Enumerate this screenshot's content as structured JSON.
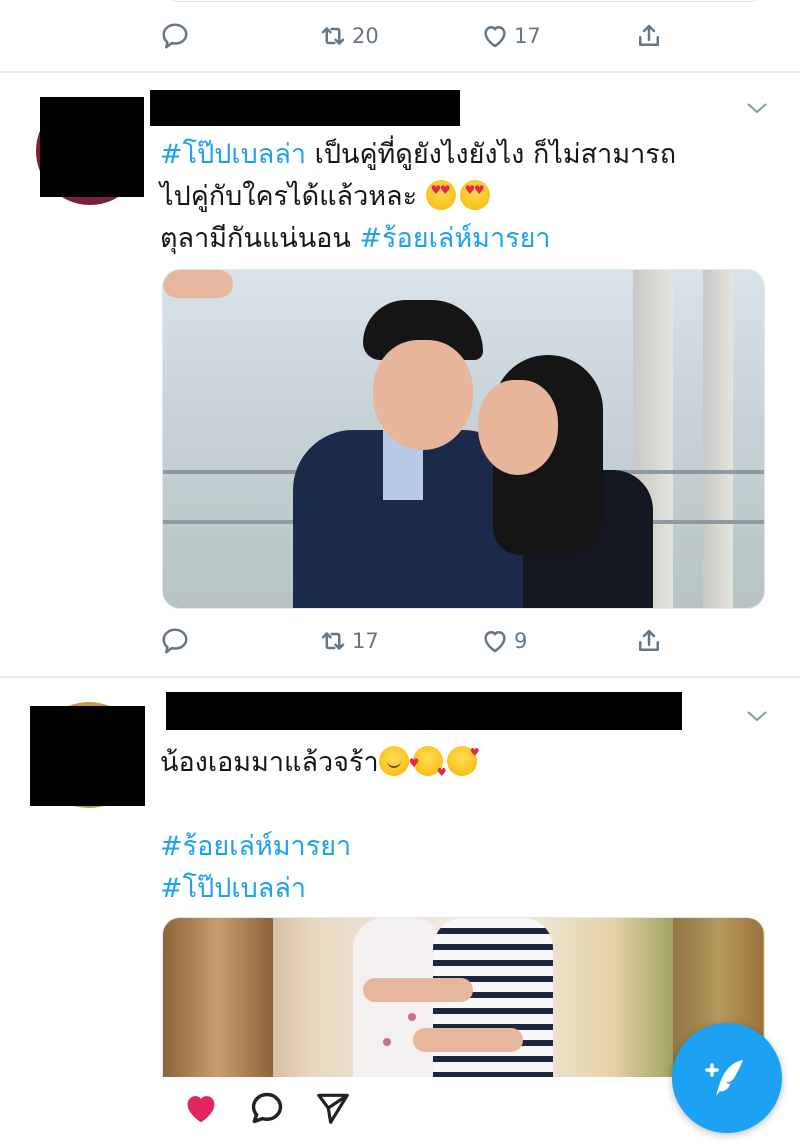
{
  "prev_tweet": {
    "actions": {
      "reply_count": "",
      "retweet_count": "20",
      "like_count": "17"
    }
  },
  "tweets": [
    {
      "text_lines": [
        [
          {
            "t": "#โป๊ปเบลล่า",
            "tag": true
          },
          {
            "t": " เป็นคู่ที่ดูยังไงยังไง ก็ไม่สามารถ",
            "tag": false
          }
        ],
        [
          {
            "t": "ไปคู่กับใครได้แล้วหละ ",
            "tag": false
          }
        ],
        [
          {
            "t": "ตุลามีกันแน่นอน ",
            "tag": false
          },
          {
            "t": "#ร้อยเล่ห์มารยา",
            "tag": true
          }
        ]
      ],
      "emojis": [
        "heart-eyes-emoji",
        "heart-eyes-emoji"
      ],
      "actions": {
        "reply_count": "",
        "retweet_count": "17",
        "like_count": "9"
      }
    },
    {
      "text_lines": [
        [
          {
            "t": "น้องเอมมาแล้วจร้า",
            "tag": false
          }
        ],
        [
          {
            "t": "",
            "tag": false
          }
        ],
        [
          {
            "t": "#ร้อยเล่ห์มารยา",
            "tag": true
          }
        ],
        [
          {
            "t": "#โป๊ปเบลล่า",
            "tag": true
          }
        ]
      ],
      "emojis": [
        "smiling-blush-emoji",
        "smiling-hearts-emoji",
        "kiss-emoji"
      ]
    }
  ],
  "icons": {
    "reply": "reply-icon",
    "retweet": "retweet-icon",
    "like": "heart-outline-icon",
    "share": "share-icon",
    "caret": "chevron-down-icon",
    "compose": "compose-tweet-icon",
    "bottom": [
      "heart-filled-icon",
      "comment-bubble-icon",
      "send-icon"
    ]
  },
  "colors": {
    "accent": "#1da1f2",
    "muted": "#657786",
    "like_red": "#e0245e"
  }
}
